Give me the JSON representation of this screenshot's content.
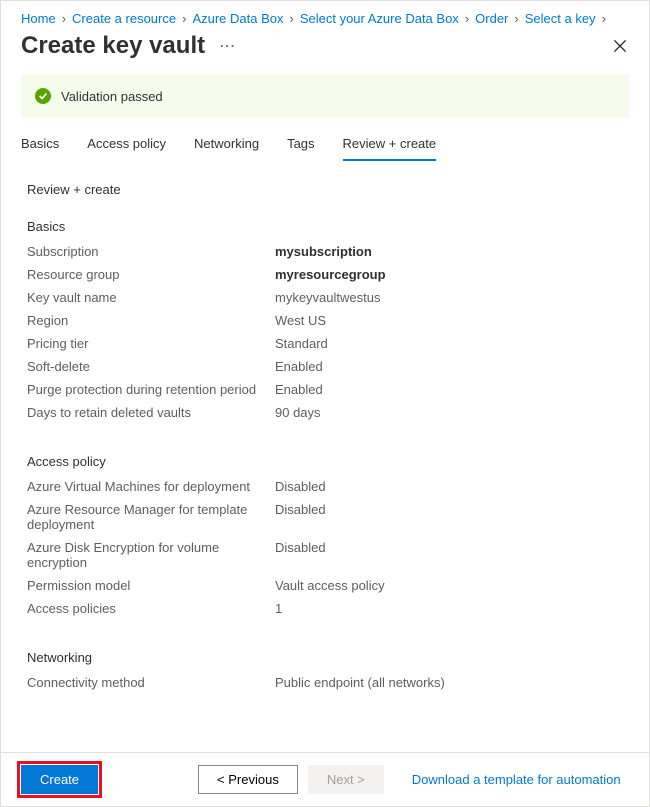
{
  "breadcrumb": [
    {
      "label": "Home"
    },
    {
      "label": "Create a resource"
    },
    {
      "label": "Azure Data Box"
    },
    {
      "label": "Select your Azure Data Box"
    },
    {
      "label": "Order"
    },
    {
      "label": "Select a key"
    }
  ],
  "page": {
    "title": "Create key vault",
    "validation_message": "Validation passed"
  },
  "tabs": [
    {
      "label": "Basics"
    },
    {
      "label": "Access policy"
    },
    {
      "label": "Networking"
    },
    {
      "label": "Tags"
    },
    {
      "label": "Review + create"
    }
  ],
  "section_title": "Review + create",
  "groups": {
    "basics": {
      "heading": "Basics",
      "rows": [
        {
          "label": "Subscription",
          "value": "mysubscription",
          "bold": true
        },
        {
          "label": "Resource group",
          "value": "myresourcegroup",
          "bold": true
        },
        {
          "label": "Key vault name",
          "value": "mykeyvaultwestus"
        },
        {
          "label": "Region",
          "value": "West US"
        },
        {
          "label": "Pricing tier",
          "value": "Standard"
        },
        {
          "label": "Soft-delete",
          "value": "Enabled"
        },
        {
          "label": "Purge protection during retention period",
          "value": "Enabled"
        },
        {
          "label": "Days to retain deleted vaults",
          "value": "90 days"
        }
      ]
    },
    "access": {
      "heading": "Access policy",
      "rows": [
        {
          "label": "Azure Virtual Machines for deployment",
          "value": "Disabled"
        },
        {
          "label": "Azure Resource Manager for template deployment",
          "value": "Disabled"
        },
        {
          "label": "Azure Disk Encryption for volume encryption",
          "value": "Disabled"
        },
        {
          "label": "Permission model",
          "value": "Vault access policy"
        },
        {
          "label": "Access policies",
          "value": "1"
        }
      ]
    },
    "networking": {
      "heading": "Networking",
      "rows": [
        {
          "label": "Connectivity method",
          "value": "Public endpoint (all networks)"
        }
      ]
    }
  },
  "footer": {
    "create": "Create",
    "previous": "< Previous",
    "next": "Next >",
    "download_link": "Download a template for automation"
  }
}
